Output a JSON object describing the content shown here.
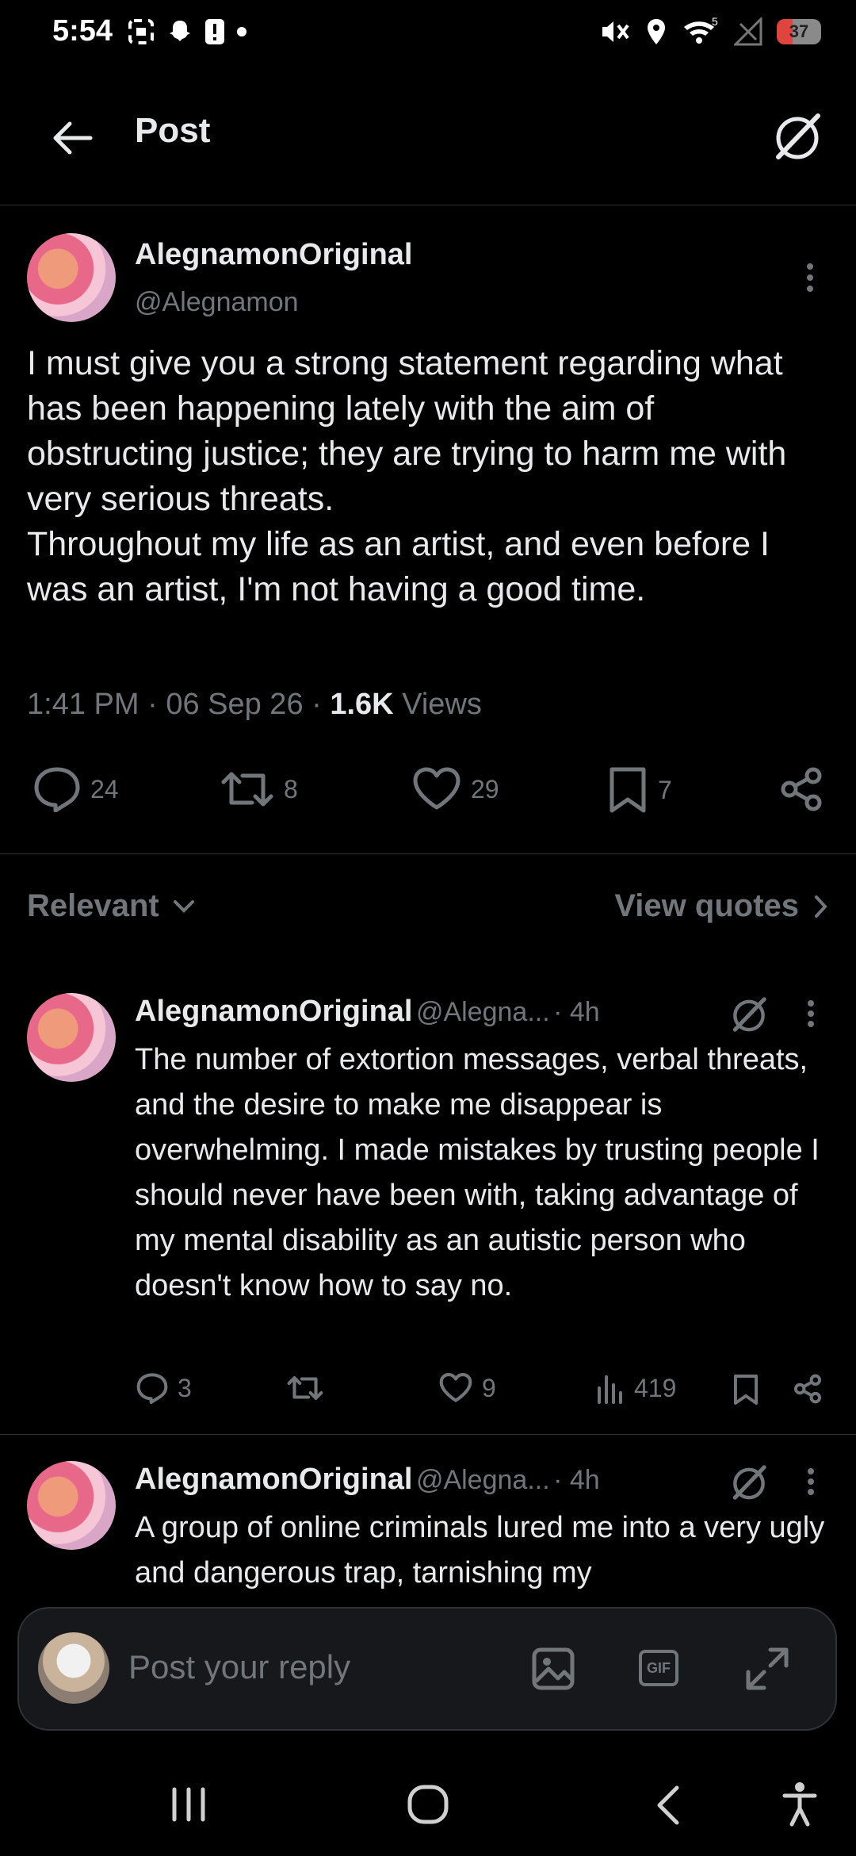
{
  "status_bar": {
    "time": "5:54",
    "battery": "37"
  },
  "header": {
    "title": "Post"
  },
  "post": {
    "display_name": "AlegnamonOriginal",
    "handle": "@Alegnamon",
    "text": "I must give you a strong statement regarding what has been happening lately with the aim of obstructing justice; they are trying to harm me with very serious threats.\nThroughout my life as an artist, and even before I was an artist, I'm not having a good time.",
    "time": "1:41 PM",
    "date": "06 Sep 26",
    "views_count": "1.6K",
    "views_label": "Views",
    "stats": {
      "replies": "24",
      "reposts": "8",
      "likes": "29",
      "bookmarks": "7"
    }
  },
  "sort": {
    "label": "Relevant",
    "view_quotes": "View quotes"
  },
  "replies": [
    {
      "display_name": "AlegnamonOriginal",
      "handle": "@Alegna...",
      "age": "· 4h",
      "text": "The number of extortion messages, verbal threats, and the desire to make me disappear is overwhelming. I made mistakes by trusting people I should never have been with, taking advantage of my mental disability as an autistic person who doesn't know how to say no.",
      "stats": {
        "replies": "3",
        "reposts": "",
        "likes": "9",
        "views": "419"
      }
    },
    {
      "display_name": "AlegnamonOriginal",
      "handle": "@Alegna...",
      "age": "· 4h",
      "text": "A group of online criminals lured me into a very ugly and dangerous trap, tarnishing my"
    }
  ],
  "composer": {
    "placeholder": "Post your reply",
    "gif_label": "GIF"
  }
}
